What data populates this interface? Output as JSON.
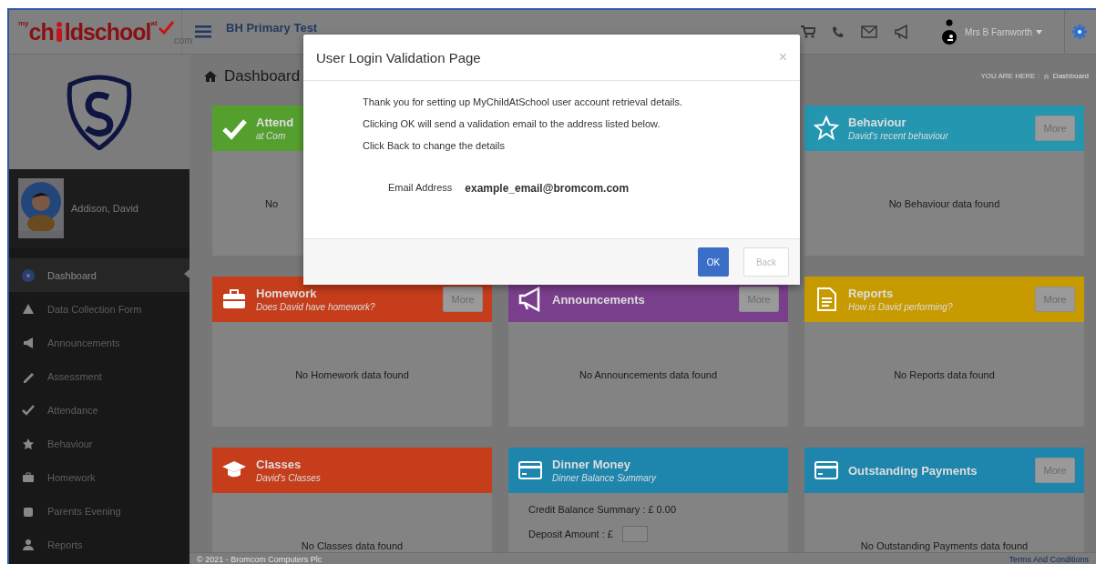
{
  "header": {
    "logo": {
      "prefix": "my",
      "part_1": "ch",
      "part_2": "ldschool",
      "at": "at",
      "suffix": "com"
    },
    "school_name": "BH Primary Test",
    "user_name": "Mrs B Farnworth"
  },
  "sidebar": {
    "student_name": "Addison, David",
    "items": [
      {
        "label": "Dashboard",
        "selected": true
      },
      {
        "label": "Data Collection Form",
        "selected": false
      },
      {
        "label": "Announcements",
        "selected": false
      },
      {
        "label": "Assessment",
        "selected": false
      },
      {
        "label": "Attendance",
        "selected": false
      },
      {
        "label": "Behaviour",
        "selected": false
      },
      {
        "label": "Homework",
        "selected": false
      },
      {
        "label": "Parents Evening",
        "selected": false
      },
      {
        "label": "Reports",
        "selected": false
      }
    ]
  },
  "page_title": "Dashboard",
  "breadcrumb": [
    "YOU ARE HERE :",
    "Dashboard"
  ],
  "card_rows": [
    [
      {
        "kind": "check",
        "title": "Attend",
        "subtitle": "at Com",
        "color": "#559f2f",
        "body": [
          {
            "kind": "partial",
            "text": "No"
          }
        ]
      },
      {
        "kind": "star",
        "title": "Behaviour",
        "subtitle": "David's recent behaviour",
        "color": "#2496b0",
        "more": "More",
        "body": [
          {
            "kind": "text",
            "text": "No Behaviour data found"
          }
        ]
      }
    ],
    [
      {
        "kind": "briefcase",
        "title": "Homework",
        "subtitle": "Does David have homework?",
        "color": "#c63d1b",
        "more": "More",
        "body": [
          {
            "kind": "text",
            "text": "No Homework data found"
          }
        ]
      },
      {
        "kind": "megaphone",
        "title": "Announcements",
        "color": "#7a3f8c",
        "more": "More",
        "body": [
          {
            "kind": "text",
            "text": "No Announcements data found"
          }
        ]
      },
      {
        "kind": "document",
        "title": "Reports",
        "subtitle": "How is David performing?",
        "color": "#c79a00",
        "more": "More",
        "body": [
          {
            "kind": "text",
            "text": "No Reports data found"
          }
        ]
      }
    ],
    [
      {
        "kind": "cap",
        "title": "Classes",
        "subtitle": "David's Classes",
        "color": "#c63d1b",
        "body": [
          {
            "kind": "text",
            "text": "No Classes data found"
          }
        ]
      },
      {
        "kind": "card",
        "title": "Dinner Money",
        "subtitle": "Dinner Balance Summary",
        "color": "#1e86ad",
        "body": [
          {
            "kind": "line",
            "text": "Credit Balance Summary : £ 0.00"
          },
          {
            "kind": "deposit",
            "text": "Deposit Amount : £"
          }
        ]
      },
      {
        "kind": "card",
        "title": "Outstanding Payments",
        "color": "#1e86ad",
        "more": "More",
        "body": [
          {
            "kind": "text",
            "text": "No Outstanding Payments data found"
          }
        ]
      }
    ]
  ],
  "footer": {
    "copyright": "© 2021 - Bromcom Computers Plc",
    "link": "Terms And Conditions"
  },
  "modal": {
    "title": "User Login Validation Page",
    "close": "×",
    "paragraphs": [
      "Thank you for setting up MyChildAtSchool user account retrieval details.",
      "Clicking OK will send a validation email to the address listed below.",
      "Click Back to change the details"
    ],
    "email_label": "Email Address",
    "email_value": "example_email@bromcom.com",
    "buttons": [
      {
        "label": "OK",
        "kind": "primary"
      },
      {
        "label": "Back",
        "kind": "default"
      }
    ]
  }
}
